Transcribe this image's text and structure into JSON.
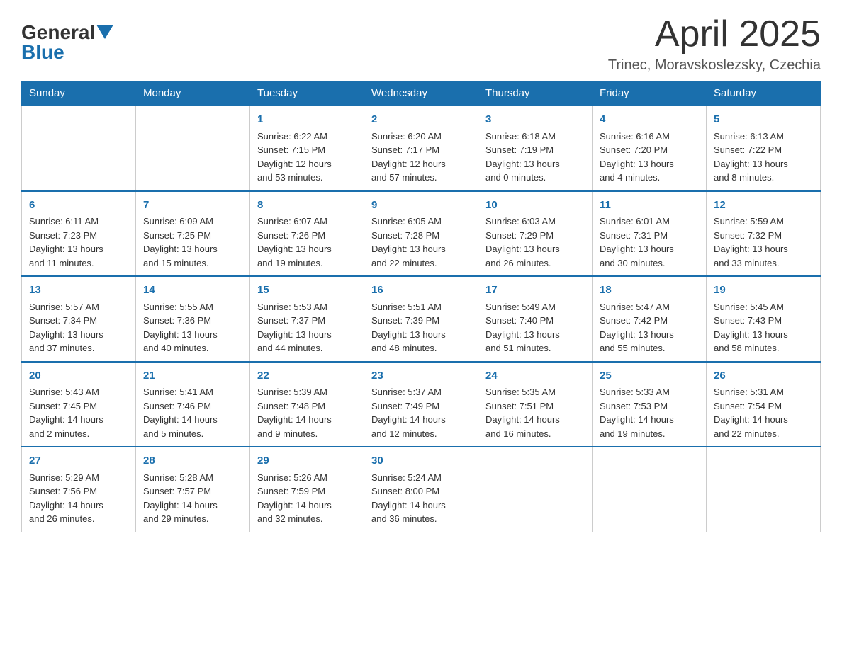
{
  "header": {
    "logo": {
      "general": "General",
      "blue": "Blue",
      "arrow": "▲"
    },
    "title": "April 2025",
    "location": "Trinec, Moravskoslezsky, Czechia"
  },
  "calendar": {
    "days_of_week": [
      "Sunday",
      "Monday",
      "Tuesday",
      "Wednesday",
      "Thursday",
      "Friday",
      "Saturday"
    ],
    "weeks": [
      [
        {
          "day": "",
          "content": ""
        },
        {
          "day": "",
          "content": ""
        },
        {
          "day": "1",
          "content": "Sunrise: 6:22 AM\nSunset: 7:15 PM\nDaylight: 12 hours\nand 53 minutes."
        },
        {
          "day": "2",
          "content": "Sunrise: 6:20 AM\nSunset: 7:17 PM\nDaylight: 12 hours\nand 57 minutes."
        },
        {
          "day": "3",
          "content": "Sunrise: 6:18 AM\nSunset: 7:19 PM\nDaylight: 13 hours\nand 0 minutes."
        },
        {
          "day": "4",
          "content": "Sunrise: 6:16 AM\nSunset: 7:20 PM\nDaylight: 13 hours\nand 4 minutes."
        },
        {
          "day": "5",
          "content": "Sunrise: 6:13 AM\nSunset: 7:22 PM\nDaylight: 13 hours\nand 8 minutes."
        }
      ],
      [
        {
          "day": "6",
          "content": "Sunrise: 6:11 AM\nSunset: 7:23 PM\nDaylight: 13 hours\nand 11 minutes."
        },
        {
          "day": "7",
          "content": "Sunrise: 6:09 AM\nSunset: 7:25 PM\nDaylight: 13 hours\nand 15 minutes."
        },
        {
          "day": "8",
          "content": "Sunrise: 6:07 AM\nSunset: 7:26 PM\nDaylight: 13 hours\nand 19 minutes."
        },
        {
          "day": "9",
          "content": "Sunrise: 6:05 AM\nSunset: 7:28 PM\nDaylight: 13 hours\nand 22 minutes."
        },
        {
          "day": "10",
          "content": "Sunrise: 6:03 AM\nSunset: 7:29 PM\nDaylight: 13 hours\nand 26 minutes."
        },
        {
          "day": "11",
          "content": "Sunrise: 6:01 AM\nSunset: 7:31 PM\nDaylight: 13 hours\nand 30 minutes."
        },
        {
          "day": "12",
          "content": "Sunrise: 5:59 AM\nSunset: 7:32 PM\nDaylight: 13 hours\nand 33 minutes."
        }
      ],
      [
        {
          "day": "13",
          "content": "Sunrise: 5:57 AM\nSunset: 7:34 PM\nDaylight: 13 hours\nand 37 minutes."
        },
        {
          "day": "14",
          "content": "Sunrise: 5:55 AM\nSunset: 7:36 PM\nDaylight: 13 hours\nand 40 minutes."
        },
        {
          "day": "15",
          "content": "Sunrise: 5:53 AM\nSunset: 7:37 PM\nDaylight: 13 hours\nand 44 minutes."
        },
        {
          "day": "16",
          "content": "Sunrise: 5:51 AM\nSunset: 7:39 PM\nDaylight: 13 hours\nand 48 minutes."
        },
        {
          "day": "17",
          "content": "Sunrise: 5:49 AM\nSunset: 7:40 PM\nDaylight: 13 hours\nand 51 minutes."
        },
        {
          "day": "18",
          "content": "Sunrise: 5:47 AM\nSunset: 7:42 PM\nDaylight: 13 hours\nand 55 minutes."
        },
        {
          "day": "19",
          "content": "Sunrise: 5:45 AM\nSunset: 7:43 PM\nDaylight: 13 hours\nand 58 minutes."
        }
      ],
      [
        {
          "day": "20",
          "content": "Sunrise: 5:43 AM\nSunset: 7:45 PM\nDaylight: 14 hours\nand 2 minutes."
        },
        {
          "day": "21",
          "content": "Sunrise: 5:41 AM\nSunset: 7:46 PM\nDaylight: 14 hours\nand 5 minutes."
        },
        {
          "day": "22",
          "content": "Sunrise: 5:39 AM\nSunset: 7:48 PM\nDaylight: 14 hours\nand 9 minutes."
        },
        {
          "day": "23",
          "content": "Sunrise: 5:37 AM\nSunset: 7:49 PM\nDaylight: 14 hours\nand 12 minutes."
        },
        {
          "day": "24",
          "content": "Sunrise: 5:35 AM\nSunset: 7:51 PM\nDaylight: 14 hours\nand 16 minutes."
        },
        {
          "day": "25",
          "content": "Sunrise: 5:33 AM\nSunset: 7:53 PM\nDaylight: 14 hours\nand 19 minutes."
        },
        {
          "day": "26",
          "content": "Sunrise: 5:31 AM\nSunset: 7:54 PM\nDaylight: 14 hours\nand 22 minutes."
        }
      ],
      [
        {
          "day": "27",
          "content": "Sunrise: 5:29 AM\nSunset: 7:56 PM\nDaylight: 14 hours\nand 26 minutes."
        },
        {
          "day": "28",
          "content": "Sunrise: 5:28 AM\nSunset: 7:57 PM\nDaylight: 14 hours\nand 29 minutes."
        },
        {
          "day": "29",
          "content": "Sunrise: 5:26 AM\nSunset: 7:59 PM\nDaylight: 14 hours\nand 32 minutes."
        },
        {
          "day": "30",
          "content": "Sunrise: 5:24 AM\nSunset: 8:00 PM\nDaylight: 14 hours\nand 36 minutes."
        },
        {
          "day": "",
          "content": ""
        },
        {
          "day": "",
          "content": ""
        },
        {
          "day": "",
          "content": ""
        }
      ]
    ]
  }
}
